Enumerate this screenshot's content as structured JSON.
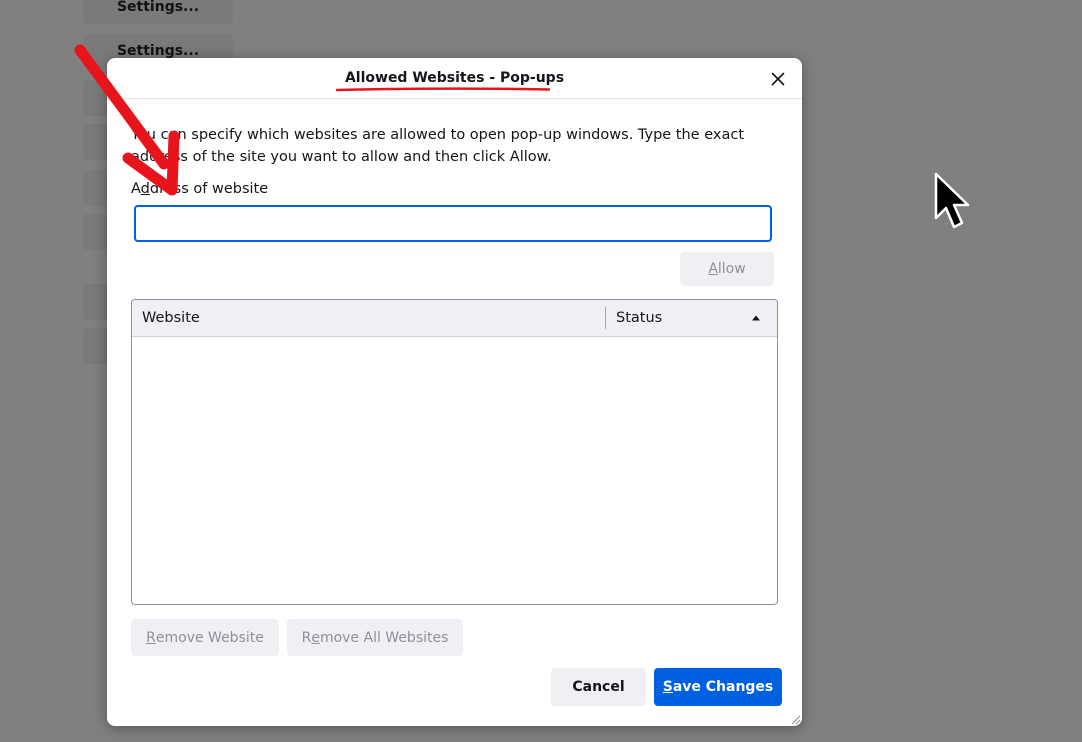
{
  "background": {
    "buttons": [
      "Settings...",
      "Settings..."
    ]
  },
  "dialog": {
    "title": "Allowed Websites - Pop-ups",
    "close_icon": "close-icon",
    "description": "You can specify which websites are allowed to open pop-up windows. Type the exact address of the site you want to allow and then click Allow.",
    "address_label_first": "A",
    "address_label_access": "d",
    "address_label_rest": "dress of website",
    "address_input": {
      "value": "",
      "placeholder": ""
    },
    "allow_button": {
      "access": "A",
      "rest": "llow"
    },
    "table": {
      "columns": [
        "Website",
        "Status"
      ],
      "sort_icon": "sort-ascending-icon",
      "rows": []
    },
    "remove_button": {
      "access": "R",
      "rest": "emove Website"
    },
    "remove_all_button": {
      "first": "R",
      "access": "e",
      "rest": "move All Websites"
    },
    "cancel_label": "Cancel",
    "save_button": {
      "access": "S",
      "rest": "ave Changes"
    }
  },
  "colors": {
    "accent": "#0061e0",
    "annotation": "#e8141b",
    "overlay": "#808080"
  }
}
